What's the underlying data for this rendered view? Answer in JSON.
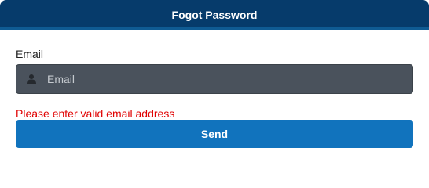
{
  "header": {
    "title": "Fogot Password"
  },
  "form": {
    "email_label": "Email",
    "email_placeholder": "Email",
    "email_value": "",
    "error_message": "Please enter valid email address",
    "send_label": "Send"
  },
  "icons": {
    "email_field_icon": "user-icon"
  },
  "colors": {
    "header_bg": "#063b6b",
    "input_bg": "#4a525c",
    "error": "#e00000",
    "button_bg": "#1173bd"
  }
}
